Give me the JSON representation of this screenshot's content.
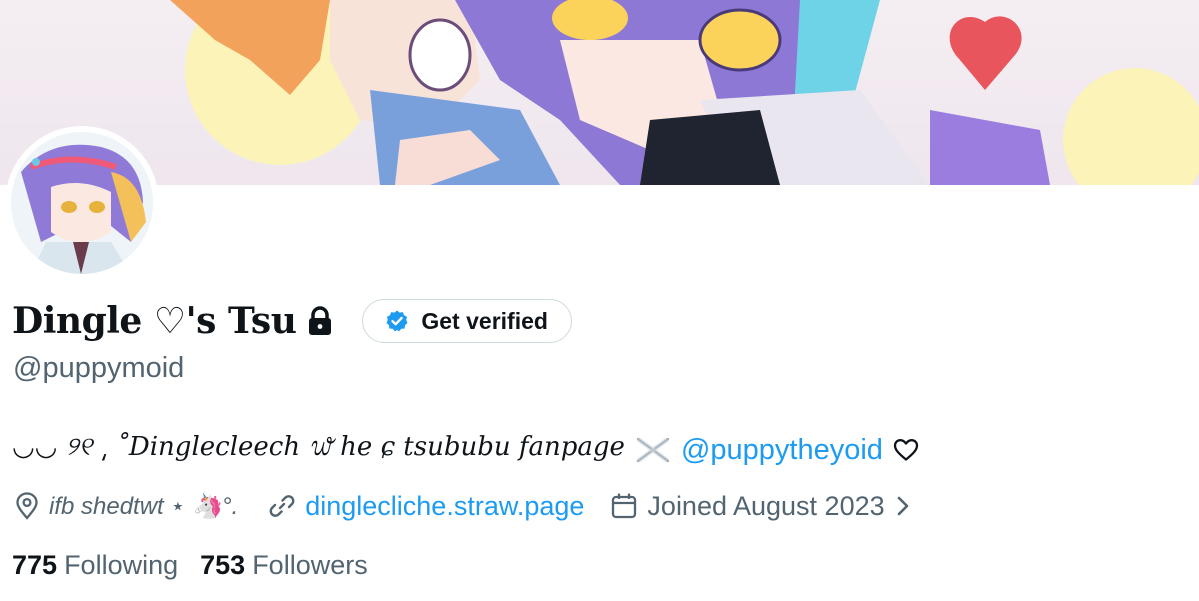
{
  "profile": {
    "display_name": "Dingle ♡'s Tsu",
    "handle": "@puppymoid",
    "verify_label": "Get verified",
    "bio": {
      "text": "◡◡ ୨୧ ͵ ˚Dinglecleech ᭙ he ɕ tsububu fanpage",
      "mention": "@puppytheyoid"
    },
    "location": "ifb shedtwt ⋆ 🦄°.",
    "website": "dinglecliche.straw.page",
    "joined": "Joined August 2023",
    "following_count": "775",
    "following_label": "Following",
    "followers_count": "753",
    "followers_label": "Followers"
  },
  "icons": {
    "lock": "lock-icon",
    "verified_badge": "verified-badge-icon",
    "heart": "heart-outline-icon",
    "location": "location-pin-icon",
    "link": "link-icon",
    "calendar": "calendar-icon",
    "chevron": "chevron-right-icon"
  },
  "colors": {
    "text_primary": "#0f1419",
    "text_secondary": "#536471",
    "link": "#1d9bf0",
    "border": "#cfd9de",
    "verified_badge": "#1d9bf0"
  }
}
